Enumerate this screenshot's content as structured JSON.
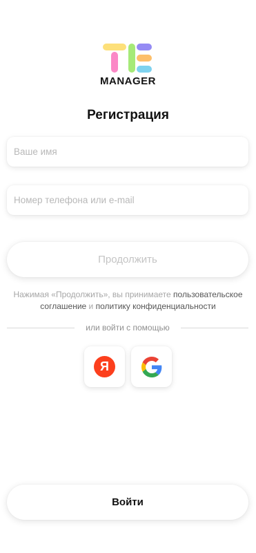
{
  "brand": {
    "logo_icon": "tm-logo-icon",
    "name": "MANAGER"
  },
  "title": "Регистрация",
  "form": {
    "name_placeholder": "Ваше имя",
    "contact_placeholder": "Номер телефона или e-mail",
    "continue_label": "Продолжить"
  },
  "terms": {
    "prefix": "Нажимая «Продолжить», вы принимаете ",
    "agreement_link": "пользовательское соглашение",
    "conjunction": " и ",
    "privacy_link": "политику конфиденциальности"
  },
  "divider_text": "или войти с помощью",
  "social": [
    {
      "name": "Яндекс",
      "icon": "yandex-icon",
      "glyph": "Я",
      "color": "#fc3f1d"
    },
    {
      "name": "Google",
      "icon": "google-icon"
    }
  ],
  "login_label": "Войти",
  "colors": {
    "logo_yellow": "#fde07a",
    "logo_pink": "#fb88c6",
    "logo_green": "#a6ea78",
    "logo_purple": "#958bf4",
    "logo_orange": "#fdbf6b",
    "logo_blue": "#7ed2ef",
    "muted_text": "#a6a6a6",
    "link_text": "#555555"
  }
}
